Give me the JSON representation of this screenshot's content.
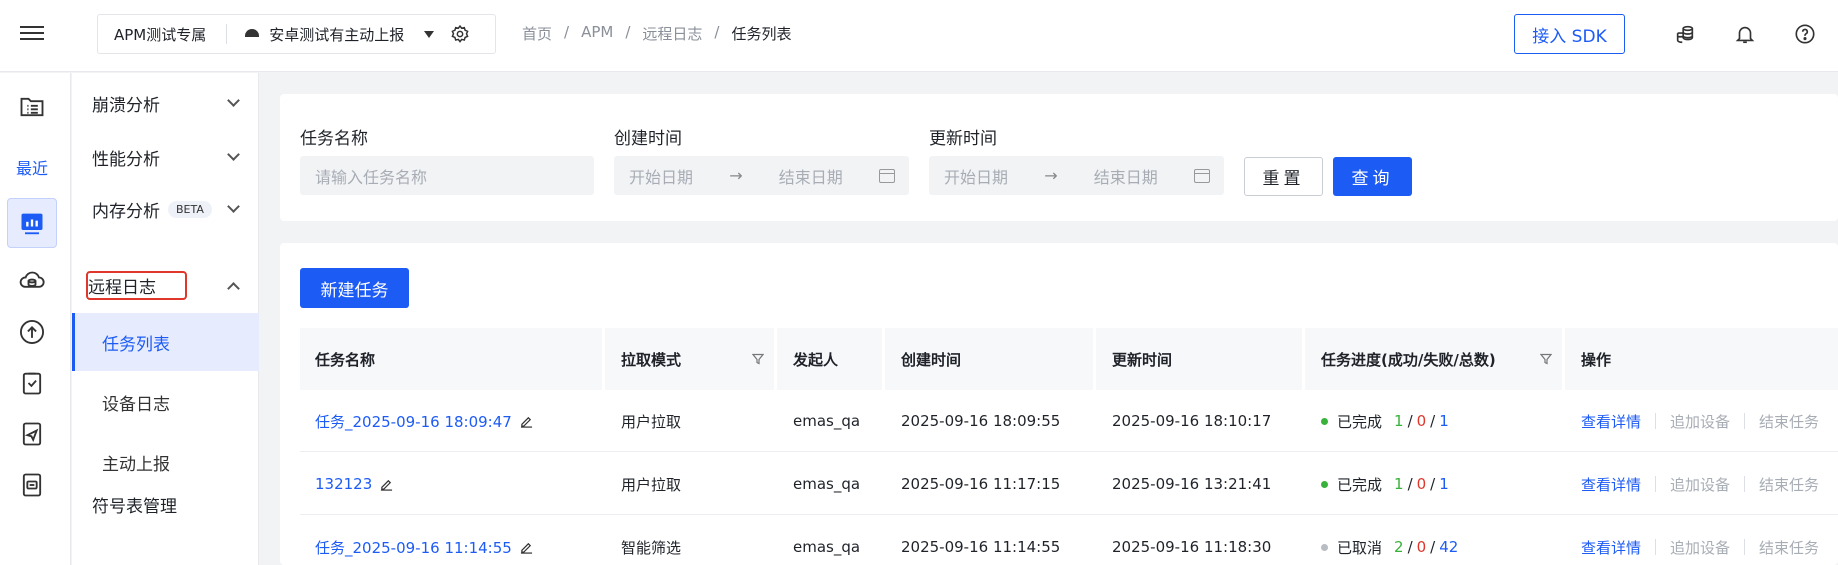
{
  "header": {
    "workspace": "APM测试专属",
    "app_name": "安卓测试有主动上报",
    "breadcrumb": [
      "首页",
      "APM",
      "远程日志",
      "任务列表"
    ],
    "sdk_button": "接入 SDK"
  },
  "rail": {
    "recent_label": "最近"
  },
  "nav": {
    "groups": [
      {
        "label": "崩溃分析"
      },
      {
        "label": "性能分析"
      },
      {
        "label": "内存分析",
        "badge": "BETA"
      },
      {
        "label": "远程日志"
      }
    ],
    "sub_items": [
      {
        "label": "任务列表"
      },
      {
        "label": "设备日志"
      },
      {
        "label": "主动上报"
      }
    ],
    "symbol_table": "符号表管理"
  },
  "filters": {
    "task_name_label": "任务名称",
    "task_name_placeholder": "请输入任务名称",
    "created_label": "创建时间",
    "updated_label": "更新时间",
    "start_placeholder": "开始日期",
    "end_placeholder": "结束日期",
    "arrow": "→",
    "reset_label": "重置",
    "query_label": "查询"
  },
  "table": {
    "new_button": "新建任务",
    "columns": [
      "任务名称",
      "拉取模式",
      "发起人",
      "创建时间",
      "更新时间",
      "任务进度(成功/失败/总数)",
      "操作"
    ],
    "rows": [
      {
        "name": "任务_2025-09-16 18:09:47",
        "mode": "用户拉取",
        "initiator": "emas_qa",
        "created": "2025-09-16 18:09:55",
        "updated": "2025-09-16 18:10:17",
        "status": "已完成",
        "status_color": "#38b23a",
        "success": "1",
        "fail": "0",
        "total": "1"
      },
      {
        "name": "132123",
        "mode": "用户拉取",
        "initiator": "emas_qa",
        "created": "2025-09-16 11:17:15",
        "updated": "2025-09-16 13:21:41",
        "status": "已完成",
        "status_color": "#38b23a",
        "success": "1",
        "fail": "0",
        "total": "1"
      },
      {
        "name": "任务_2025-09-16 11:14:55",
        "mode": "智能筛选",
        "initiator": "emas_qa",
        "created": "2025-09-16 11:14:55",
        "updated": "2025-09-16 11:18:30",
        "status": "已取消",
        "status_color": "#b8bcc3",
        "success": "2",
        "fail": "0",
        "total": "42"
      }
    ],
    "actions": {
      "view": "查看详情",
      "add_device": "追加设备",
      "end_task": "结束任务"
    }
  }
}
